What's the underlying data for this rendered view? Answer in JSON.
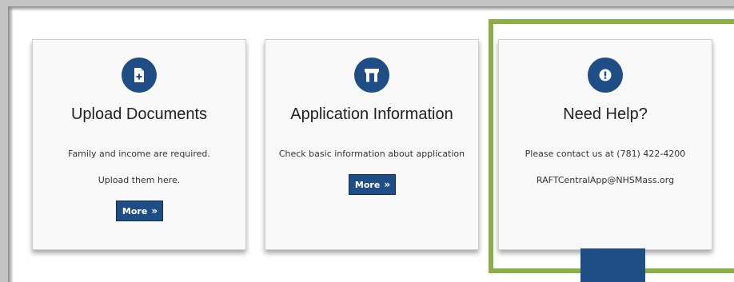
{
  "cards": [
    {
      "icon": "add-document-icon",
      "title": "Upload Documents",
      "lines": [
        "Family and income are required.",
        "Upload them here."
      ],
      "button": "More"
    },
    {
      "icon": "archway-icon",
      "title": "Application Information",
      "lines": [
        "Check basic information about application"
      ],
      "button": "More"
    },
    {
      "icon": "exclamation-icon",
      "title": "Need Help?",
      "lines": [
        "Please contact us at (781) 422-4200",
        "RAFTCentralApp@NHSMass.org"
      ]
    }
  ],
  "colors": {
    "primary": "#1f4e86",
    "highlight": "#8cae46",
    "card_bg": "#f8f8f8"
  }
}
